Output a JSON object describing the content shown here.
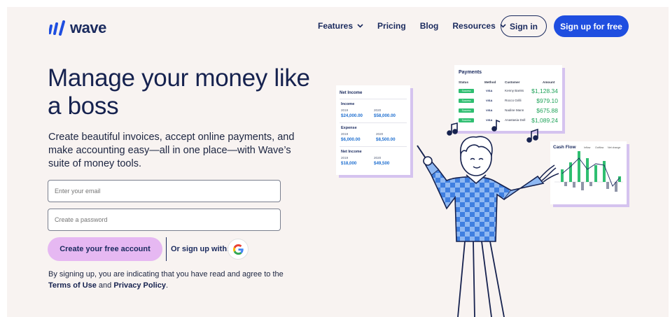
{
  "header": {
    "logo_text": "wave",
    "nav": [
      {
        "label": "Features",
        "has_dropdown": true
      },
      {
        "label": "Pricing",
        "has_dropdown": false
      },
      {
        "label": "Blog",
        "has_dropdown": false
      },
      {
        "label": "Resources",
        "has_dropdown": true
      }
    ],
    "signin_label": "Sign in",
    "signup_label": "Sign up for free"
  },
  "hero": {
    "title": "Manage your money like a boss",
    "subtitle": "Create beautiful invoices, accept online payments, and make accounting easy—all in one place—with Wave’s suite of money tools."
  },
  "form": {
    "email_placeholder": "Enter your email",
    "password_placeholder": "Create a password",
    "create_label": "Create your free account",
    "or_label": "Or sign up with:",
    "legal_prefix": "By signing up, you are indicating that you have read and agree to the ",
    "terms_label": "Terms of Use",
    "legal_and": " and ",
    "privacy_label": "Privacy Policy",
    "legal_suffix": "."
  },
  "net_income_card": {
    "title": "Net Income",
    "sections": [
      {
        "label": "Income",
        "y1": "2019",
        "v1": "$24,000.00",
        "y2": "2020",
        "v2": "$58,000.00"
      },
      {
        "label": "Expense",
        "y1": "2019",
        "v1": "$6,000.00",
        "y2": "2020",
        "v2": "$8,500.00"
      },
      {
        "label": "Net Income",
        "y1": "2019",
        "v1": "$18,000",
        "y2": "2020",
        "v2": "$49,500"
      }
    ]
  },
  "payments_card": {
    "title": "Payments",
    "headers": [
      "Status",
      "Method",
      "Customer",
      "Amount"
    ],
    "rows": [
      {
        "status": "Success",
        "method": "VISA",
        "customer": "Kenny Banks",
        "amount": "$1,128.34"
      },
      {
        "status": "Success",
        "method": "VISA",
        "customer": "Rocco Grilli",
        "amount": "$979.10"
      },
      {
        "status": "Success",
        "method": "VISA",
        "customer": "Nadine Mann",
        "amount": "$675.88"
      },
      {
        "status": "Success",
        "method": "VISA",
        "customer": "Anastasia Doll",
        "amount": "$1,089.24"
      }
    ]
  },
  "cash_flow_card": {
    "title": "Cash Flow",
    "legend": [
      "Inflow",
      "Outflow",
      "Net change"
    ]
  },
  "colors": {
    "brand_blue": "#1f4ee0",
    "navy": "#16224f",
    "lavender": "#e6b8f2",
    "bg": "#f8f3f1",
    "success": "#2fbf71"
  }
}
